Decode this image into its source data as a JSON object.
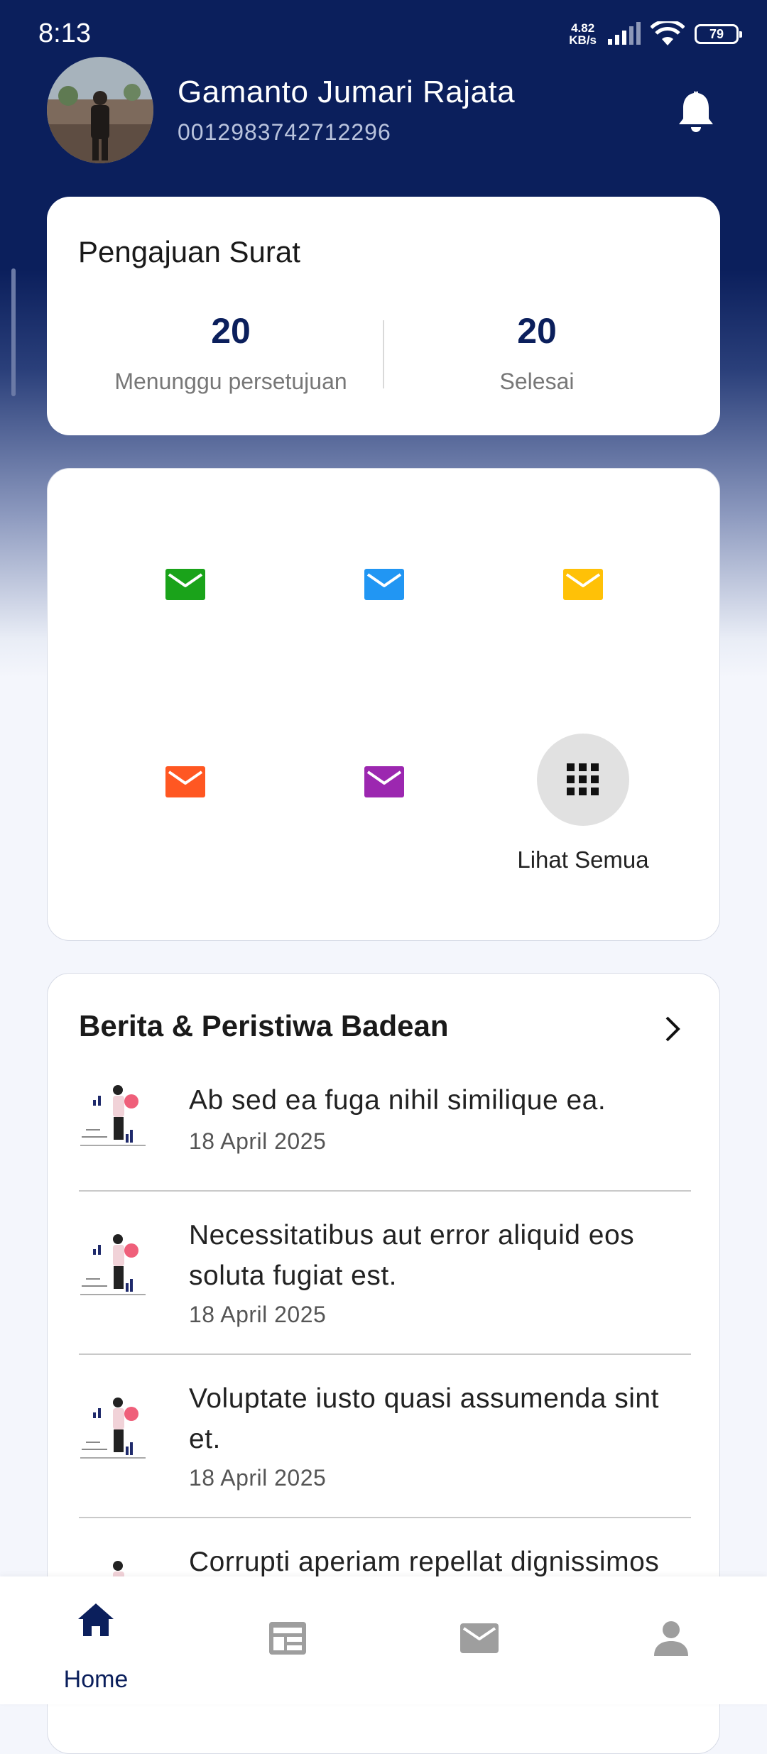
{
  "status_bar": {
    "time": "8:13",
    "net_speed_value": "4.82",
    "net_speed_unit": "KB/s",
    "battery": "79"
  },
  "user": {
    "name": "Gamanto Jumari Rajata",
    "id": "0012983742712296"
  },
  "summary": {
    "title": "Pengajuan Surat",
    "pending_count": "20",
    "pending_label": "Menunggu persetujuan",
    "done_count": "20",
    "done_label": "Selesai"
  },
  "menu": {
    "tiles": [
      {
        "icon": "mail-icon",
        "color": "#1aa31a"
      },
      {
        "icon": "mail-icon",
        "color": "#2196f3"
      },
      {
        "icon": "mail-icon",
        "color": "#ffc107"
      },
      {
        "icon": "mail-icon",
        "color": "#ff5722"
      },
      {
        "icon": "mail-icon",
        "color": "#9c27b0"
      }
    ],
    "see_all_label": "Lihat Semua"
  },
  "news": {
    "title": "Berita & Peristiwa Badean",
    "items": [
      {
        "headline": "Ab sed ea fuga nihil similique ea.",
        "date": "18 April 2025"
      },
      {
        "headline": "Necessitatibus aut error aliquid eos soluta fugiat est.",
        "date": "18 April 2025"
      },
      {
        "headline": "Voluptate iusto quasi assumenda sint et.",
        "date": "18 April 2025"
      },
      {
        "headline": "Corrupti aperiam repellat dignissimos",
        "date": ""
      }
    ]
  },
  "bottom_nav": {
    "items": [
      {
        "label": "Home",
        "icon": "home-icon",
        "active": true
      },
      {
        "label": "",
        "icon": "newspaper-icon",
        "active": false
      },
      {
        "label": "",
        "icon": "mail-icon",
        "active": false
      },
      {
        "label": "",
        "icon": "person-icon",
        "active": false
      }
    ]
  },
  "colors": {
    "primary": "#0b1f5c",
    "inactive_icon": "#9e9e9e"
  }
}
